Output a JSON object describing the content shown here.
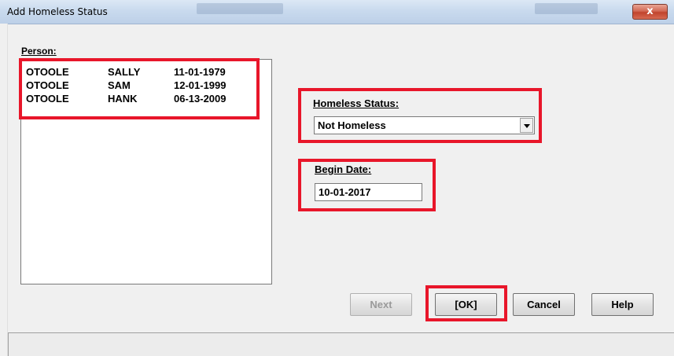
{
  "window": {
    "title": "Add Homeless Status",
    "close_label": "x"
  },
  "person": {
    "label": "Person:",
    "rows": [
      {
        "last": "OTOOLE",
        "first": "SALLY",
        "dob": "11-01-1979"
      },
      {
        "last": "OTOOLE",
        "first": "SAM",
        "dob": "12-01-1999"
      },
      {
        "last": "OTOOLE",
        "first": "HANK",
        "dob": "06-13-2009"
      }
    ]
  },
  "homeless_status": {
    "label": "Homeless Status:",
    "selected": "Not Homeless"
  },
  "begin_date": {
    "label": "Begin Date:",
    "value": "10-01-2017"
  },
  "buttons": {
    "next": "Next",
    "ok": "[OK]",
    "cancel": "Cancel",
    "help": "Help"
  },
  "colors": {
    "highlight": "#e8162a",
    "close_button": "#c0432c"
  }
}
